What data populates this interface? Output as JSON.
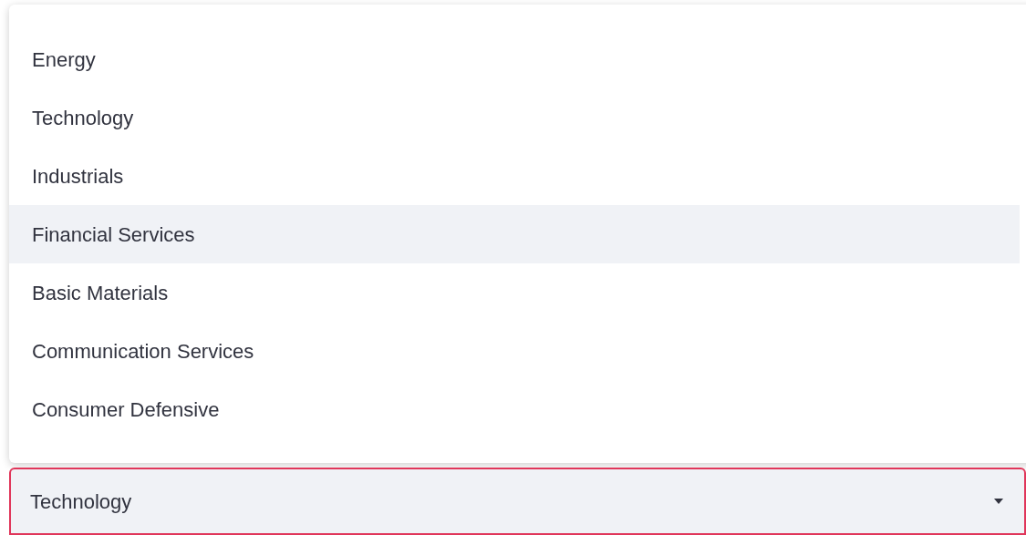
{
  "menu": {
    "items": [
      {
        "label": "Energy",
        "selected": false
      },
      {
        "label": "Technology",
        "selected": false
      },
      {
        "label": "Industrials",
        "selected": false
      },
      {
        "label": "Financial Services",
        "selected": true
      },
      {
        "label": "Basic Materials",
        "selected": false
      },
      {
        "label": "Communication Services",
        "selected": false
      },
      {
        "label": "Consumer Defensive",
        "selected": false
      }
    ]
  },
  "select": {
    "value": "Technology",
    "focused": true
  }
}
